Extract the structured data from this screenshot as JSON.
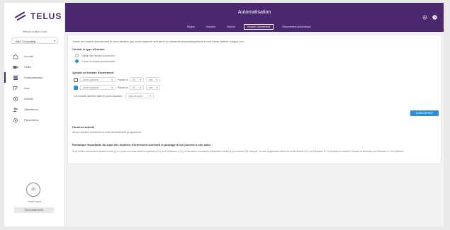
{
  "sidebar": {
    "logo_text": "TELUS",
    "back_link": "Retour à Mon Coin",
    "company_select": "ABC Consulting",
    "items": [
      {
        "label": "Accueil",
        "icon": "home-icon"
      },
      {
        "label": "Vidéo",
        "icon": "video-icon"
      },
      {
        "label": "Automatisation",
        "icon": "automation-icon"
      },
      {
        "label": "Avis",
        "icon": "reviews-icon"
      },
      {
        "label": "Activité",
        "icon": "activity-icon"
      },
      {
        "label": "Utilisateurs",
        "icon": "users-icon"
      },
      {
        "label": "Paramètres",
        "icon": "settings-icon"
      }
    ],
    "active_index": 2,
    "avatar_initials": "JD",
    "user_name": "JeanDupont",
    "logout_label": "DÉCONNEXION"
  },
  "header": {
    "title": "Automatisation",
    "tabs": [
      "Règles",
      "Horaires",
      "Scènes",
      "Horaires d'armement",
      "Réarmement automatique"
    ],
    "active_tab": 3
  },
  "main": {
    "intro": "Créez un horaire d'armement si vous désirez que votre système soit armé ou désarmé automatiquement à une heure définie chaque jour.",
    "type_heading": "Choisir le type d'horaire",
    "type_options": [
      "Utiliser les heures d'ouverture",
      "Créer un horaire personnalisé"
    ],
    "add_heading": "Ajouter un horaire d'armement",
    "rows": [
      {
        "mode": "Armer (Absent)",
        "at_label": "Passer à",
        "hour": "00",
        "minute": "min"
      },
      {
        "mode": "Armer (Absent)",
        "at_label": "Passer à",
        "hour": "00",
        "minute": "min"
      }
    ],
    "days_label": "Cet horaire doit être actif les jours suivants :",
    "days_value": "Tous les jours",
    "save_label": "ENREGISTRER",
    "current_heading": "Horaires actuels",
    "current_empty": "Aucun horaire d'armement n'est actuellement programmé.",
    "remark_heading": "Remarque importante au sujet des horaires d'armement couvrant le passage d'une journée à une autre :",
    "remark_text": "Si un horaire d'armement dépasse minuit (p. ex. Armer en mode Absence système à 22 h et le Désarmer à 7 h), le deuxième commande d'armement suivant le jour suivant. Par exemple : si vous programmez Armer en mode Absent à 22 h et Désarmer à 7 h du lundi au vendredi, l'horaire se terminera par Désarmer à 7 h le Samedi."
  },
  "colors": {
    "brand": "#4b286d",
    "accent": "#2b8fd8"
  }
}
